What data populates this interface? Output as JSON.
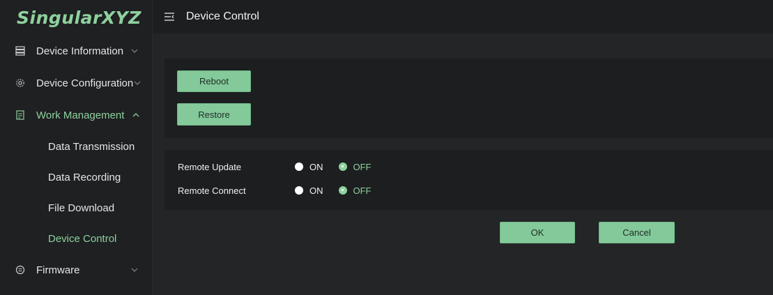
{
  "logo": "SingularXYZ",
  "topbar": {
    "title": "Device Control"
  },
  "sidebar": {
    "items": [
      {
        "label": "Device Information",
        "expanded": false
      },
      {
        "label": "Device Configuration",
        "expanded": false
      },
      {
        "label": "Work Management",
        "expanded": true,
        "active": true
      },
      {
        "label": "Firmware",
        "expanded": false
      }
    ],
    "sub_items": [
      {
        "label": "Data Transmission"
      },
      {
        "label": "Data Recording"
      },
      {
        "label": "File Download"
      },
      {
        "label": "Device Control",
        "active": true
      }
    ]
  },
  "actions": {
    "reboot_label": "Reboot",
    "restore_label": "Restore"
  },
  "settings": [
    {
      "label": "Remote Update",
      "on_label": "ON",
      "off_label": "OFF",
      "selected": "OFF"
    },
    {
      "label": "Remote Connect",
      "on_label": "ON",
      "off_label": "OFF",
      "selected": "OFF"
    }
  ],
  "footer": {
    "ok_label": "OK",
    "cancel_label": "Cancel"
  },
  "colors": {
    "accent": "#8fd19e",
    "button": "#83c99a",
    "background": "#1b1d1f",
    "panel": "#1c1e20"
  }
}
